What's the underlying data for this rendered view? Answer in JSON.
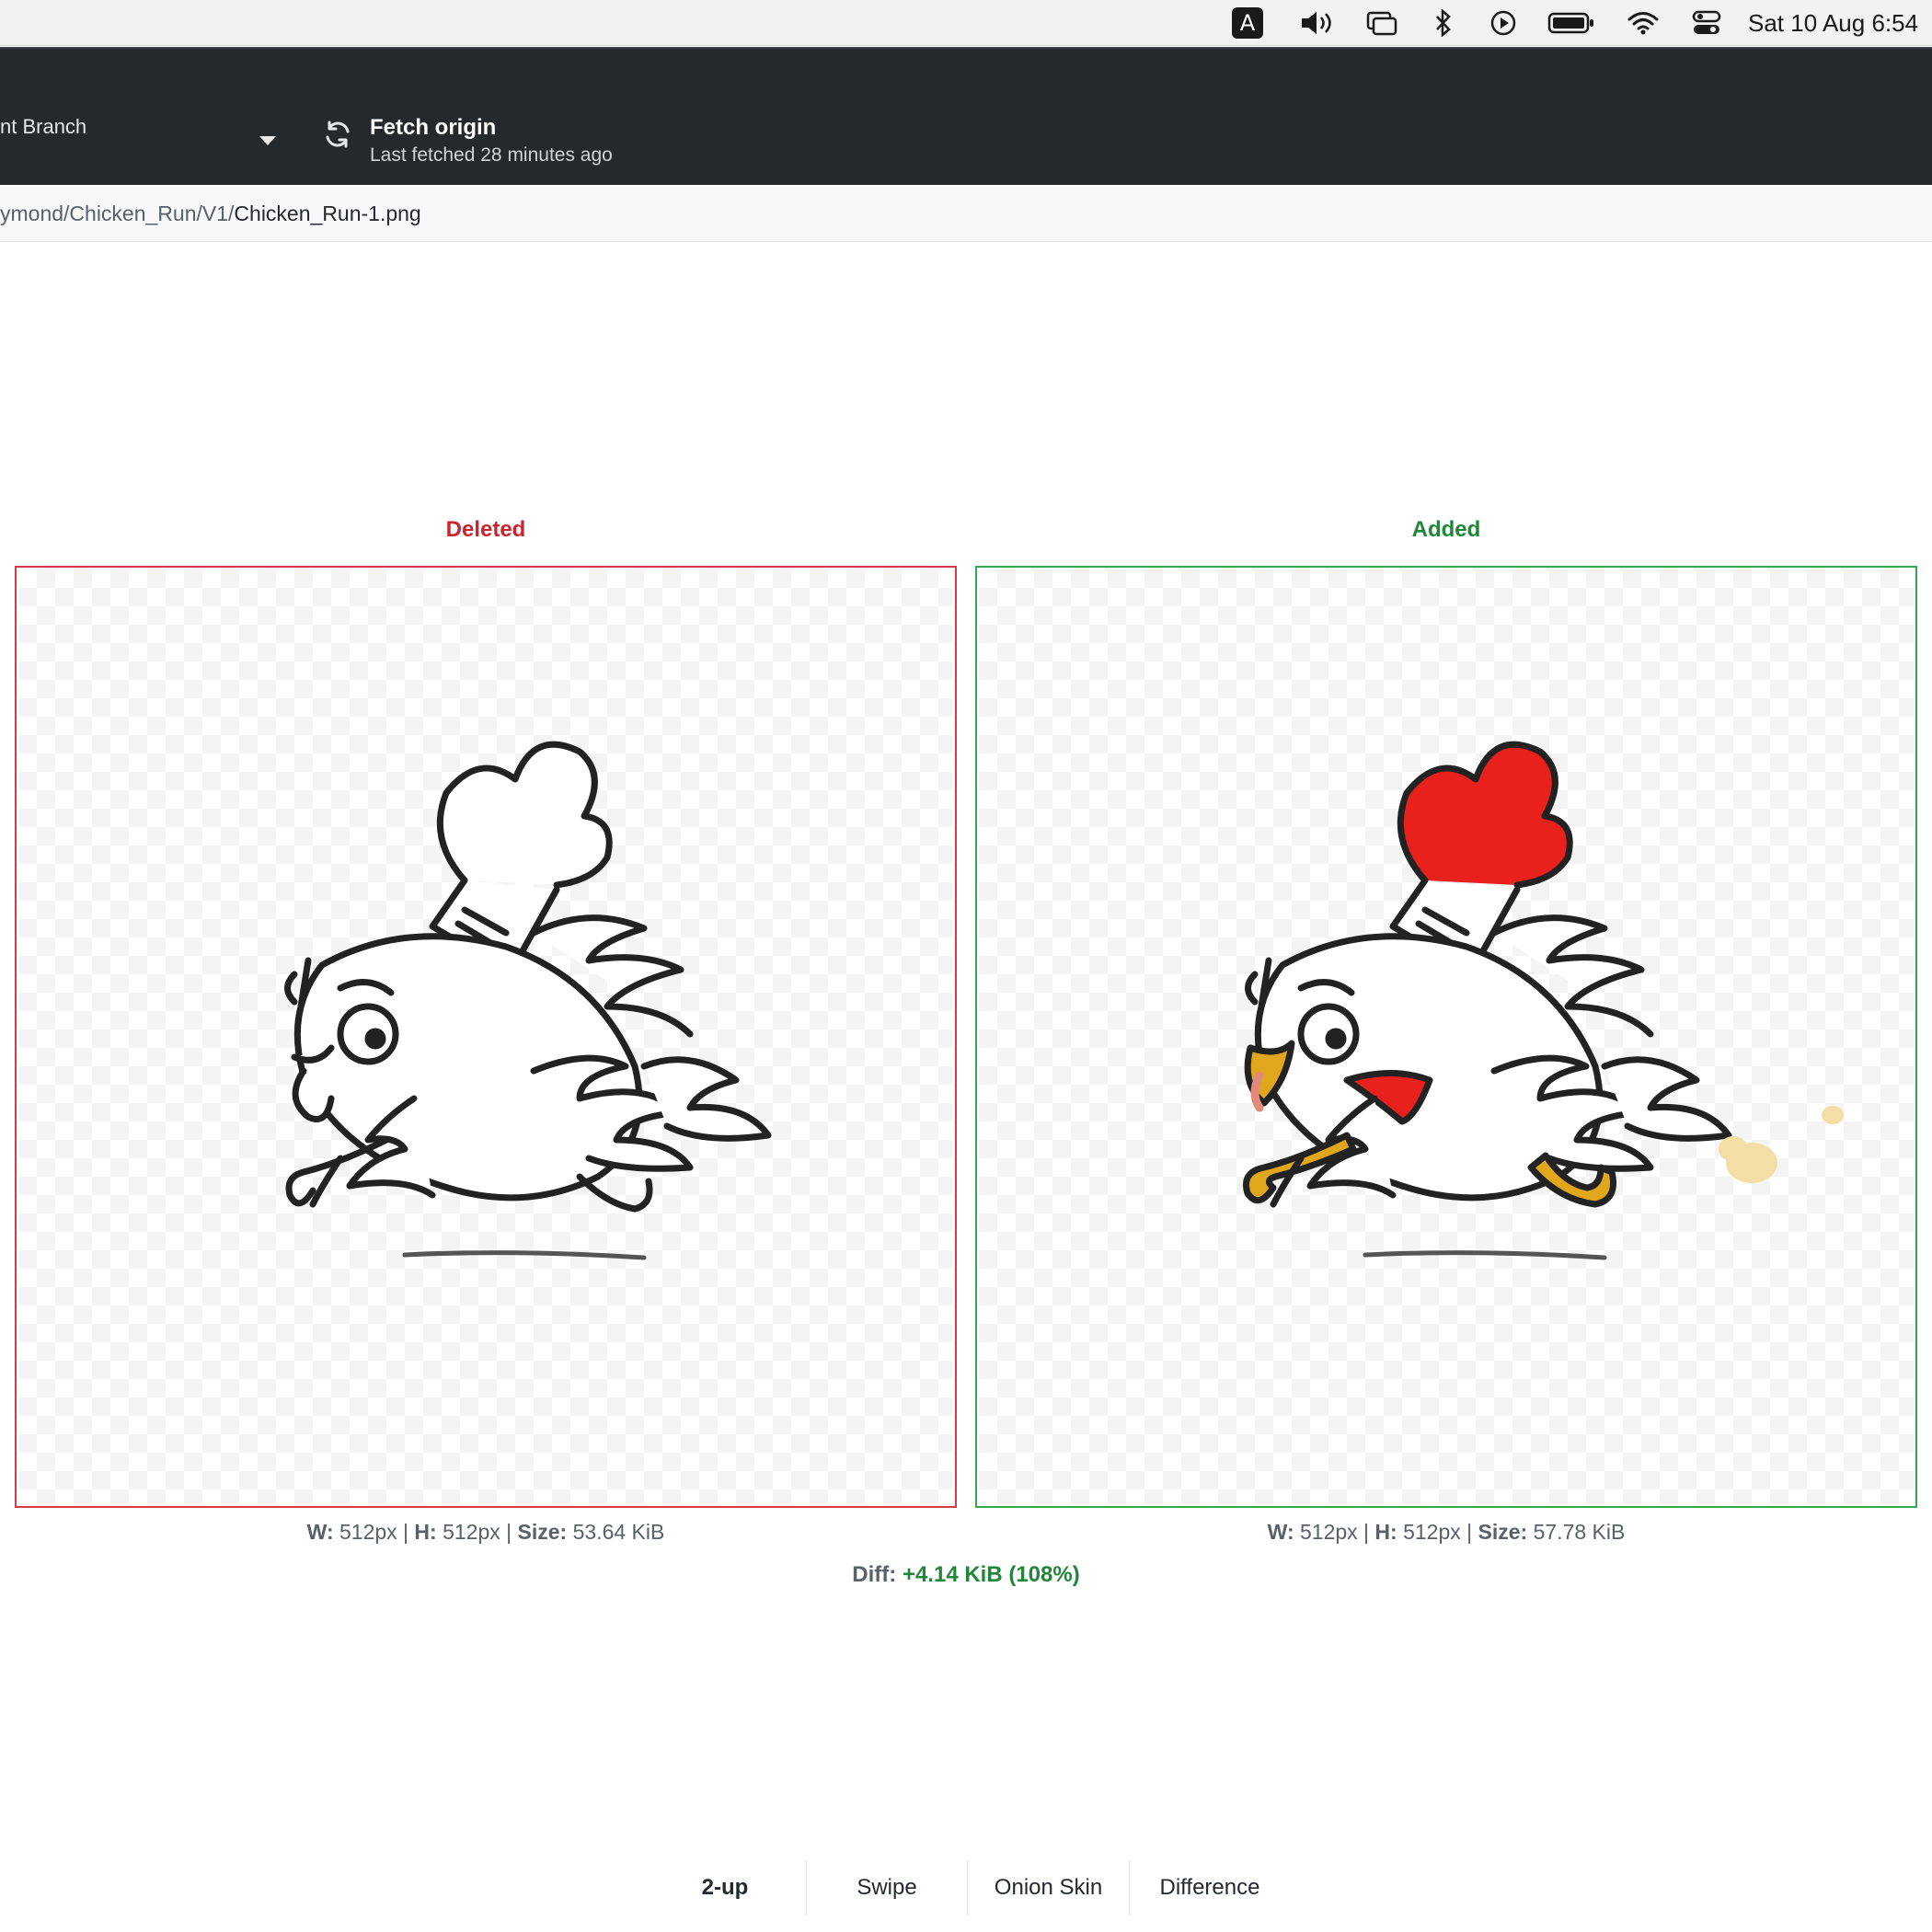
{
  "menubar": {
    "input_source": "A",
    "icons": [
      "volume-icon",
      "screen-mirroring-icon",
      "bluetooth-icon",
      "now-playing-icon",
      "battery-icon",
      "wifi-icon",
      "control-center-icon"
    ],
    "clock": "Sat 10 Aug  6:54"
  },
  "toolbar": {
    "branch_label": "nt Branch",
    "fetch_title": "Fetch origin",
    "fetch_subtitle": "Last fetched 28 minutes ago"
  },
  "path": {
    "dir": "ymond/Chicken_Run/V1/",
    "file": "Chicken_Run-1.png"
  },
  "diff": {
    "deleted_label": "Deleted",
    "added_label": "Added",
    "deleted_meta": {
      "w_key": "W:",
      "w_val": " 512px | ",
      "h_key": "H:",
      "h_val": " 512px | ",
      "size_key": "Size:",
      "size_val": " 53.64 KiB"
    },
    "added_meta": {
      "w_key": "W:",
      "w_val": " 512px | ",
      "h_key": "H:",
      "h_val": " 512px | ",
      "size_key": "Size:",
      "size_val": " 57.78 KiB"
    },
    "diff_key": "Diff: ",
    "diff_value": "+4.14 KiB (108%)",
    "colors": {
      "deleted": "#cb2431",
      "added": "#22863a"
    }
  },
  "view_modes": [
    {
      "label": "2-up",
      "active": true
    },
    {
      "label": "Swipe",
      "active": false
    },
    {
      "label": "Onion Skin",
      "active": false
    },
    {
      "label": "Difference",
      "active": false
    }
  ]
}
